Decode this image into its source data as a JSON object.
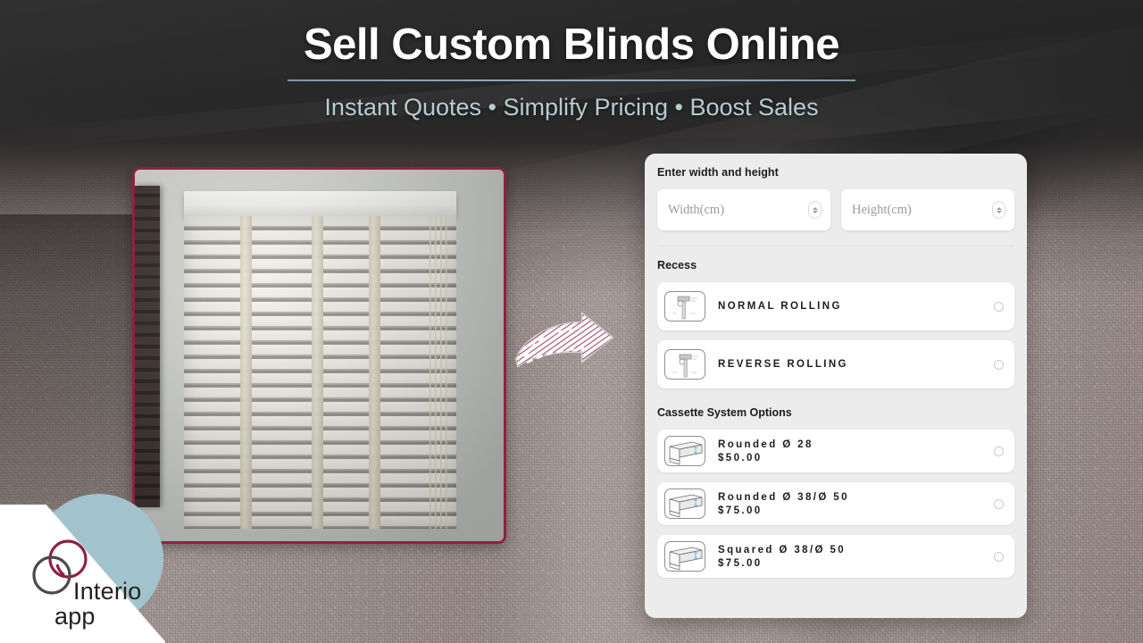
{
  "header": {
    "title": "Sell Custom Blinds Online",
    "subtitle": "Instant Quotes • Simplify Pricing • Boost Sales",
    "divider_color": "#8aa3ae",
    "title_color": "#ffffff",
    "subtitle_color": "#b9cbd3"
  },
  "logo": {
    "name_line1": "Interio",
    "name_line2": "app",
    "circle_color": "#a2c3cc",
    "ring_primary_color": "#8e2045",
    "ring_secondary_color": "#4a4a4a"
  },
  "photo": {
    "alt": "white-venetian-blinds-window-photo",
    "border_color": "#8e2045"
  },
  "arrow": {
    "name": "curved-right-arrow",
    "fill": "#ffffff",
    "hatch_color": "#8e2045"
  },
  "panel": {
    "size_section": {
      "label": "Enter width and height",
      "width_input": {
        "placeholder": "Width(cm)",
        "value": ""
      },
      "height_input": {
        "placeholder": "Height(cm)",
        "value": ""
      }
    },
    "recess_section": {
      "label": "Recess",
      "options": [
        {
          "title": "NORMAL ROLLING",
          "price": "",
          "icon": "normal-rolling-diagram-icon",
          "selected": false
        },
        {
          "title": "REVERSE ROLLING",
          "price": "",
          "icon": "reverse-rolling-diagram-icon",
          "selected": false
        }
      ]
    },
    "cassette_section": {
      "label": "Cassette System Options",
      "options": [
        {
          "title": "Rounded Ø 28",
          "price": "$50.00",
          "icon": "cassette-rounded-28-icon",
          "selected": false
        },
        {
          "title": "Rounded Ø 38/Ø 50",
          "price": "$75.00",
          "icon": "cassette-rounded-38-50-icon",
          "selected": false
        },
        {
          "title": "Squared Ø 38/Ø 50",
          "price": "$75.00",
          "icon": "cassette-squared-38-50-icon",
          "selected": false
        }
      ]
    }
  }
}
